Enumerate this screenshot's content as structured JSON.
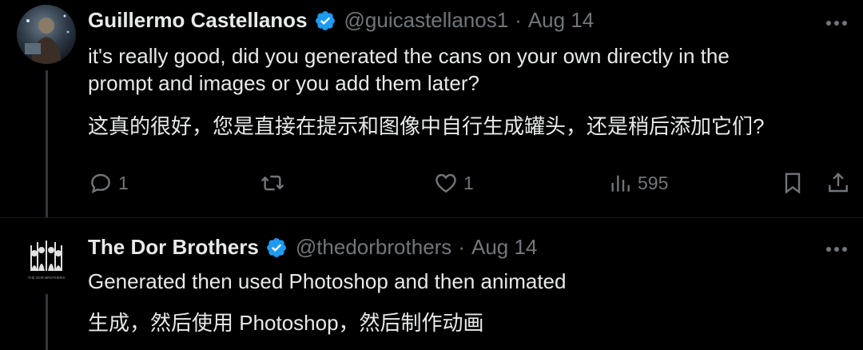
{
  "tweets": [
    {
      "name": "Guillermo Castellanos",
      "handle": "@guicastellanos1",
      "separator": "·",
      "date": "Aug 14",
      "text_en_line1": "it's really good, did you generated the cans on your own directly in the",
      "text_en_line2": "prompt and images or you add them later?",
      "text_zh": "这真的很好，您是直接在提示和图像中自行生成罐头，还是稍后添加它们?",
      "reply_count": "1",
      "like_count": "1",
      "view_count": "595"
    },
    {
      "name": "The Dor Brothers",
      "handle": "@thedorbrothers",
      "separator": "·",
      "date": "Aug 14",
      "text_en": "Generated then used Photoshop and then animated",
      "text_zh": "生成，然后使用 Photoshop，然后制作动画",
      "avatar_caption": "THE DOR BROTHERS"
    }
  ],
  "colors": {
    "background": "#000000",
    "text": "#e7e9ea",
    "muted": "#71767b",
    "verified": "#1d9bf0"
  },
  "icons": [
    "verified-badge-icon",
    "more-icon",
    "reply-icon",
    "retweet-icon",
    "like-icon",
    "views-icon",
    "bookmark-icon",
    "share-icon"
  ]
}
